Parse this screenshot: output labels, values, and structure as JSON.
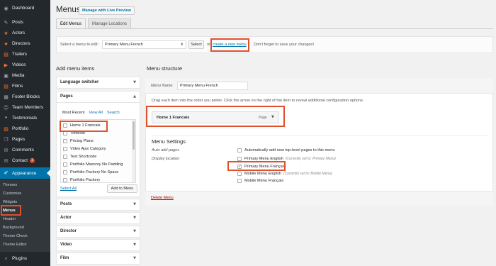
{
  "sidebar": {
    "items": [
      {
        "label": "Dashboard",
        "icon": "dashboard-icon",
        "glyph": "◉"
      },
      {
        "label": "Posts",
        "icon": "pin-icon",
        "glyph": "✎"
      },
      {
        "label": "Actors",
        "icon": "star-icon",
        "glyph": "★"
      },
      {
        "label": "Directors",
        "icon": "star-icon",
        "glyph": "★"
      },
      {
        "label": "Trailers",
        "icon": "film-icon",
        "glyph": "▤"
      },
      {
        "label": "Videos",
        "icon": "video-icon",
        "glyph": "▶"
      },
      {
        "label": "Media",
        "icon": "media-icon",
        "glyph": "▣"
      },
      {
        "label": "Films",
        "icon": "film-icon",
        "glyph": "▤"
      },
      {
        "label": "Footer Blocks",
        "icon": "block-icon",
        "glyph": "▦"
      },
      {
        "label": "Team Members",
        "icon": "people-icon",
        "glyph": "☺"
      },
      {
        "label": "Testimonials",
        "icon": "quote-icon",
        "glyph": "❝"
      },
      {
        "label": "Portfolio",
        "icon": "portfolio-icon",
        "glyph": "▨"
      },
      {
        "label": "Pages",
        "icon": "pages-icon",
        "glyph": "❐"
      },
      {
        "label": "Comments",
        "icon": "comment-icon",
        "glyph": "✉"
      },
      {
        "label": "Contact",
        "icon": "mail-icon",
        "glyph": "✉",
        "badge": "1"
      },
      {
        "label": "Appearance",
        "icon": "brush-icon",
        "glyph": "✐"
      }
    ],
    "submenu": [
      "Themes",
      "Customize",
      "Widgets",
      "Menus",
      "Header",
      "Background",
      "Theme Check",
      "Theme Editor"
    ],
    "plugins": {
      "label": "Plugins",
      "icon": "plugin-icon",
      "glyph": "⚡"
    }
  },
  "header": {
    "title": "Menus",
    "live_preview": "Manage with Live Preview",
    "tabs": [
      "Edit Menus",
      "Manage Locations"
    ]
  },
  "select_bar": {
    "label": "Select a menu to edit:",
    "selected": "Primary Menu French",
    "select_button": "Select",
    "or": "or",
    "create_link": "create a new menu",
    "note": ". Don't forget to save your changes!"
  },
  "left": {
    "heading": "Add menu items",
    "language_switcher": "Language switcher",
    "pages": "Pages",
    "tabs": [
      "Most Recent",
      "View All",
      "Search"
    ],
    "page_items": [
      "Home 1 Francais",
      "Timeline",
      "Pricing Plans",
      "Video Ajax Category",
      "Test Shortcode",
      "Portfolio Masonry No Padding",
      "Portfolio Packery No Space",
      "Portfolio Packery"
    ],
    "select_all": "Select All",
    "add_to_menu": "Add to Menu",
    "sections": [
      "Posts",
      "Actor",
      "Director",
      "Video",
      "Film"
    ]
  },
  "right": {
    "heading": "Menu structure",
    "menu_name_label": "Menu Name",
    "menu_name_value": "Primary Menu French",
    "instructions": "Drag each item into the order you prefer. Click the arrow on the right of the item to reveal additional configuration options.",
    "menu_item": {
      "title": "Home 1 Francais",
      "type": "Page"
    },
    "settings_title": "Menu Settings",
    "auto_add_label": "Auto add pages",
    "auto_add_option": "Automatically add new top-level pages to this menu",
    "display_label": "Display location",
    "locations": [
      {
        "label": "Primary Menu English",
        "note": "(Currently set to: Primary Menu)",
        "checked": false
      },
      {
        "label": "Primary Menu Français",
        "note": "",
        "checked": true
      },
      {
        "label": "Mobile Menu English",
        "note": "(Currently set to: Mobile Menu)",
        "checked": false
      },
      {
        "label": "Mobile Menu Français",
        "note": "",
        "checked": false
      }
    ],
    "delete": "Delete Menu"
  },
  "colors": {
    "accent": "#0073aa",
    "highlight": "#e0502b",
    "sidebar": "#23282d",
    "orange_icon": "#f56e28"
  }
}
